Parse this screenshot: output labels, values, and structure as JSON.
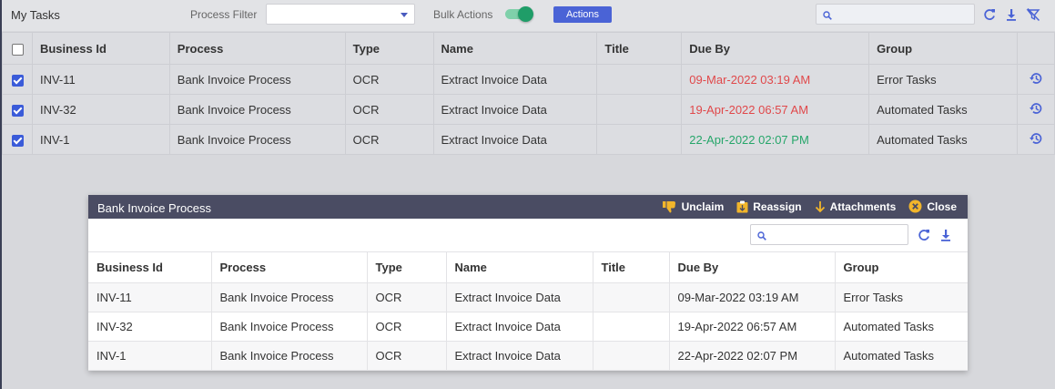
{
  "toolbar": {
    "title": "My Tasks",
    "process_filter_label": "Process Filter",
    "process_filter_value": "",
    "bulk_actions_label": "Bulk Actions",
    "bulk_actions_on": true,
    "actions_label": "Actions",
    "search_placeholder": "",
    "icons": [
      "search-icon",
      "refresh-icon",
      "download-icon",
      "clear-filter-icon"
    ]
  },
  "task_table": {
    "columns": [
      "Business Id",
      "Process",
      "Type",
      "Name",
      "Title",
      "Due By",
      "Group"
    ],
    "rows": [
      {
        "checked": true,
        "business_id": "INV-11",
        "process": "Bank Invoice Process",
        "type": "OCR",
        "name": "Extract Invoice Data",
        "title": "",
        "due_by": "09-Mar-2022 03:19 AM",
        "due_color": "#e0484a",
        "group": "Error Tasks"
      },
      {
        "checked": true,
        "business_id": "INV-32",
        "process": "Bank Invoice Process",
        "type": "OCR",
        "name": "Extract Invoice Data",
        "title": "",
        "due_by": "19-Apr-2022 06:57 AM",
        "due_color": "#e0484a",
        "group": "Automated Tasks"
      },
      {
        "checked": true,
        "business_id": "INV-1",
        "process": "Bank Invoice Process",
        "type": "OCR",
        "name": "Extract Invoice Data",
        "title": "",
        "due_by": "22-Apr-2022 02:07 PM",
        "due_color": "#26a66a",
        "group": "Automated Tasks"
      }
    ]
  },
  "dialog": {
    "title": "Bank Invoice Process",
    "actions": {
      "unclaim": "Unclaim",
      "reassign": "Reassign",
      "attachments": "Attachments",
      "close": "Close"
    },
    "search_placeholder": "",
    "columns": [
      "Business Id",
      "Process",
      "Type",
      "Name",
      "Title",
      "Due By",
      "Group"
    ],
    "rows": [
      {
        "business_id": "INV-11",
        "process": "Bank Invoice Process",
        "type": "OCR",
        "name": "Extract Invoice Data",
        "title": "",
        "due_by": "09-Mar-2022 03:19 AM",
        "group": "Error Tasks"
      },
      {
        "business_id": "INV-32",
        "process": "Bank Invoice Process",
        "type": "OCR",
        "name": "Extract Invoice Data",
        "title": "",
        "due_by": "19-Apr-2022 06:57 AM",
        "group": "Automated Tasks"
      },
      {
        "business_id": "INV-1",
        "process": "Bank Invoice Process",
        "type": "OCR",
        "name": "Extract Invoice Data",
        "title": "",
        "due_by": "22-Apr-2022 02:07 PM",
        "group": "Automated Tasks"
      }
    ]
  },
  "colors": {
    "accent": "#4a63d6",
    "overdue": "#e0484a",
    "upcoming": "#26a66a",
    "toggle_on": "#1f9d68",
    "dialog_header": "#4a4c63"
  }
}
